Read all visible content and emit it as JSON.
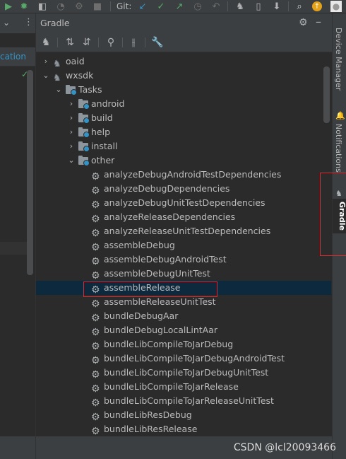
{
  "toolbar": {
    "git_label": "Git:",
    "icons": [
      "run-icon",
      "debug-icon",
      "profile-icon",
      "attach-icon",
      "coverage-icon",
      "stop-icon",
      "git-update-icon",
      "git-commit-icon",
      "git-push-icon",
      "history-icon",
      "rollback-icon",
      "sync-gradle-icon",
      "device-icon",
      "sdk-icon",
      "search-icon",
      "update-icon",
      "avatar"
    ]
  },
  "left_panel": {
    "tab_label": "cation",
    "close_glyph": "✕",
    "menu_glyph": "⋮",
    "check_glyph": "✓"
  },
  "gradle": {
    "title": "Gradle",
    "header_icons": [
      "settings-icon",
      "minimize-icon"
    ],
    "tools": [
      "elephant-icon",
      "expand-all-icon",
      "collapse-all-icon",
      "analyze-icon",
      "toggle-offline-icon",
      "wrench-icon"
    ],
    "tree": [
      {
        "indent": 1,
        "arrow": "›",
        "icon": "elephant",
        "label": "oaid"
      },
      {
        "indent": 1,
        "arrow": "⌄",
        "icon": "elephant",
        "label": "wxsdk"
      },
      {
        "indent": 2,
        "arrow": "⌄",
        "icon": "folder",
        "label": "Tasks"
      },
      {
        "indent": 3,
        "arrow": "›",
        "icon": "folder",
        "label": "android"
      },
      {
        "indent": 3,
        "arrow": "›",
        "icon": "folder",
        "label": "build"
      },
      {
        "indent": 3,
        "arrow": "›",
        "icon": "folder",
        "label": "help"
      },
      {
        "indent": 3,
        "arrow": "›",
        "icon": "folder",
        "label": "install"
      },
      {
        "indent": 3,
        "arrow": "⌄",
        "icon": "folder",
        "label": "other"
      },
      {
        "indent": 4,
        "arrow": "",
        "icon": "gear",
        "label": "analyzeDebugAndroidTestDependencies"
      },
      {
        "indent": 4,
        "arrow": "",
        "icon": "gear",
        "label": "analyzeDebugDependencies"
      },
      {
        "indent": 4,
        "arrow": "",
        "icon": "gear",
        "label": "analyzeDebugUnitTestDependencies"
      },
      {
        "indent": 4,
        "arrow": "",
        "icon": "gear",
        "label": "analyzeReleaseDependencies"
      },
      {
        "indent": 4,
        "arrow": "",
        "icon": "gear",
        "label": "analyzeReleaseUnitTestDependencies"
      },
      {
        "indent": 4,
        "arrow": "",
        "icon": "gear",
        "label": "assembleDebug"
      },
      {
        "indent": 4,
        "arrow": "",
        "icon": "gear",
        "label": "assembleDebugAndroidTest"
      },
      {
        "indent": 4,
        "arrow": "",
        "icon": "gear",
        "label": "assembleDebugUnitTest"
      },
      {
        "indent": 4,
        "arrow": "",
        "icon": "gear",
        "label": "assembleRelease",
        "selected": true
      },
      {
        "indent": 4,
        "arrow": "",
        "icon": "gear",
        "label": "assembleReleaseUnitTest"
      },
      {
        "indent": 4,
        "arrow": "",
        "icon": "gear",
        "label": "bundleDebugAar"
      },
      {
        "indent": 4,
        "arrow": "",
        "icon": "gear",
        "label": "bundleDebugLocalLintAar"
      },
      {
        "indent": 4,
        "arrow": "",
        "icon": "gear",
        "label": "bundleLibCompileToJarDebug"
      },
      {
        "indent": 4,
        "arrow": "",
        "icon": "gear",
        "label": "bundleLibCompileToJarDebugAndroidTest"
      },
      {
        "indent": 4,
        "arrow": "",
        "icon": "gear",
        "label": "bundleLibCompileToJarDebugUnitTest"
      },
      {
        "indent": 4,
        "arrow": "",
        "icon": "gear",
        "label": "bundleLibCompileToJarRelease"
      },
      {
        "indent": 4,
        "arrow": "",
        "icon": "gear",
        "label": "bundleLibCompileToJarReleaseUnitTest"
      },
      {
        "indent": 4,
        "arrow": "",
        "icon": "gear",
        "label": "bundleLibResDebug"
      },
      {
        "indent": 4,
        "arrow": "",
        "icon": "gear",
        "label": "bundleLibResRelease"
      }
    ]
  },
  "right_strip": {
    "tabs": [
      {
        "label": "Device Manager",
        "icon": "device-manager-icon"
      },
      {
        "label": "Notifications",
        "icon": "bell-icon"
      },
      {
        "label": "Gradle",
        "icon": "elephant-icon",
        "active": true
      }
    ]
  },
  "watermark": "CSDN @lcl20093466",
  "colors": {
    "background": "#2b2b2b",
    "panel": "#3c3f41",
    "selection": "#0d293e",
    "accent_blue": "#3592c4",
    "annotation_red": "#e0282e",
    "run_green": "#59a869"
  }
}
